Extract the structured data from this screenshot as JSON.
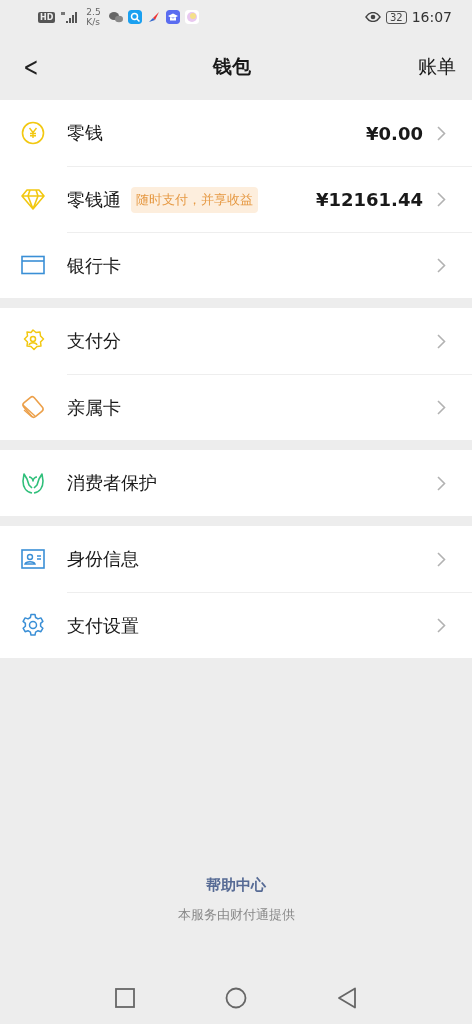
{
  "status_bar": {
    "network": "HD",
    "speed": [
      "2.5",
      "K/s"
    ],
    "battery": "32",
    "time": "16:07"
  },
  "nav": {
    "back": "<",
    "title": "钱包",
    "action": "账单"
  },
  "groups": [
    {
      "items": [
        {
          "label": "零钱",
          "value": "¥0.00"
        },
        {
          "label": "零钱通",
          "tag": "随时支付，并享收益",
          "value": "¥12161.44"
        },
        {
          "label": "银行卡"
        }
      ]
    },
    {
      "items": [
        {
          "label": "支付分"
        },
        {
          "label": "亲属卡"
        }
      ]
    },
    {
      "items": [
        {
          "label": "消费者保护"
        }
      ]
    },
    {
      "items": [
        {
          "label": "身份信息"
        },
        {
          "label": "支付设置"
        }
      ]
    }
  ],
  "footer": {
    "link": "帮助中心",
    "note": "本服务由财付通提供"
  }
}
